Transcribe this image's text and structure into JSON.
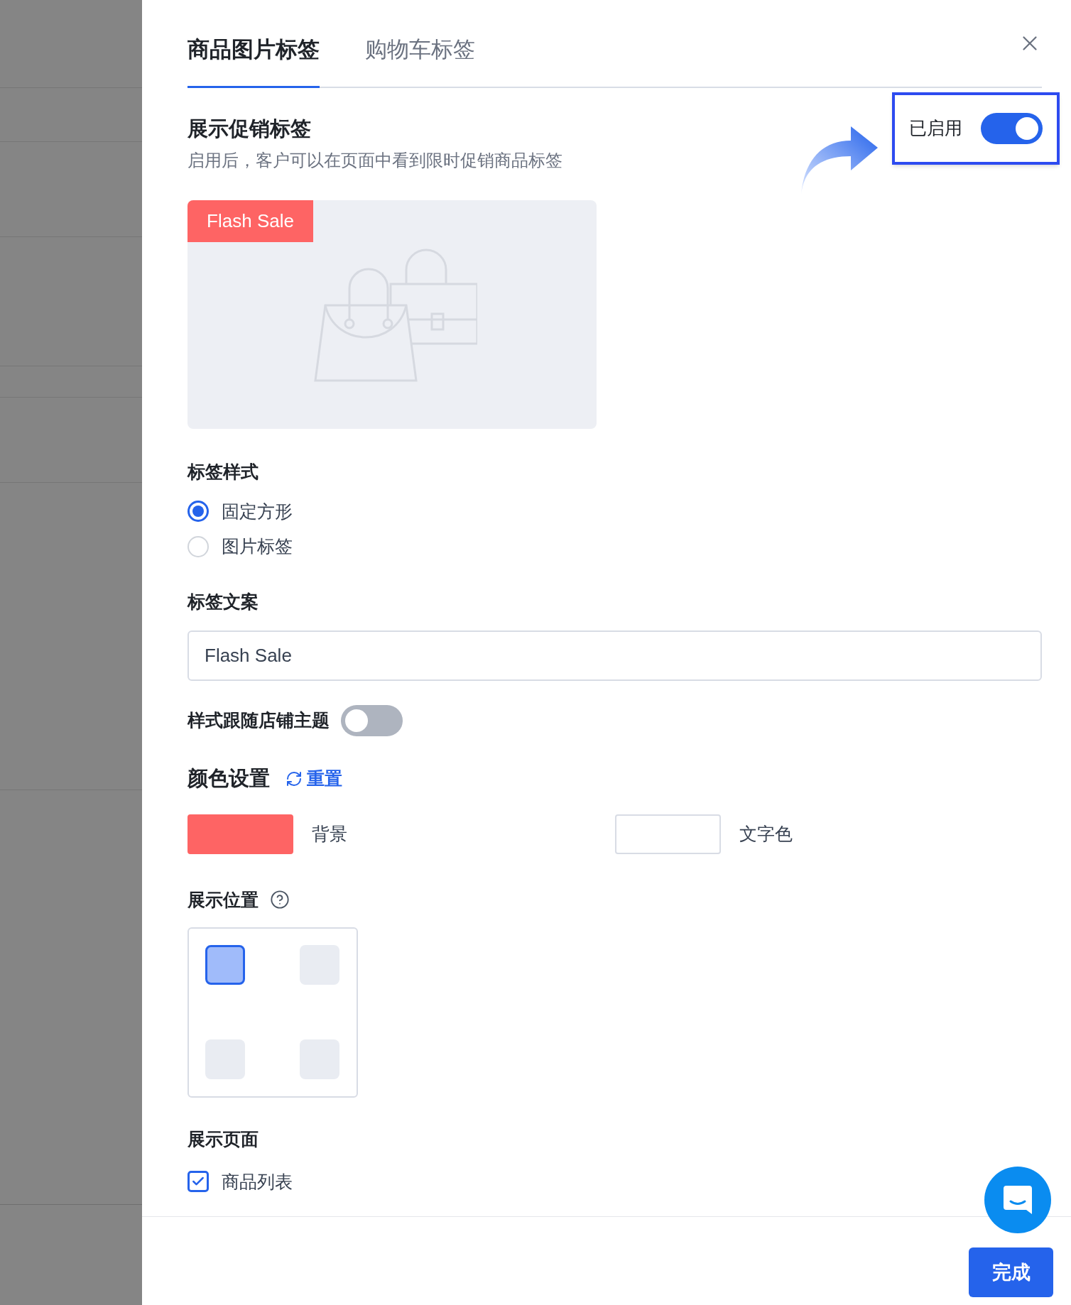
{
  "tabs": [
    {
      "label": "商品图片标签",
      "selected": true
    },
    {
      "label": "购物车标签",
      "selected": false
    }
  ],
  "promo": {
    "title": "展示促销标签",
    "description": "启用后，客户可以在页面中看到限时促销商品标签",
    "enabled_label": "已启用",
    "enabled": true
  },
  "preview": {
    "badge": "Flash Sale"
  },
  "label_style": {
    "title": "标签样式",
    "options": [
      {
        "label": "固定方形",
        "selected": true
      },
      {
        "label": "图片标签",
        "selected": false
      }
    ]
  },
  "label_text": {
    "title": "标签文案",
    "value": "Flash Sale"
  },
  "follow_theme": {
    "label": "样式跟随店铺主题",
    "on": false
  },
  "colors": {
    "title": "颜色设置",
    "reset": "重置",
    "swatches": [
      {
        "label": "背景",
        "color": "#fe6464"
      },
      {
        "label": "文字色",
        "color": "#ffffff"
      }
    ]
  },
  "position": {
    "title": "展示位置",
    "cells": [
      {
        "selected": true
      },
      {
        "selected": false
      },
      {
        "selected": false
      },
      {
        "selected": false
      }
    ]
  },
  "pages": {
    "title": "展示页面",
    "items": [
      {
        "label": "商品列表",
        "checked": true
      }
    ]
  },
  "footer": {
    "done": "完成"
  }
}
